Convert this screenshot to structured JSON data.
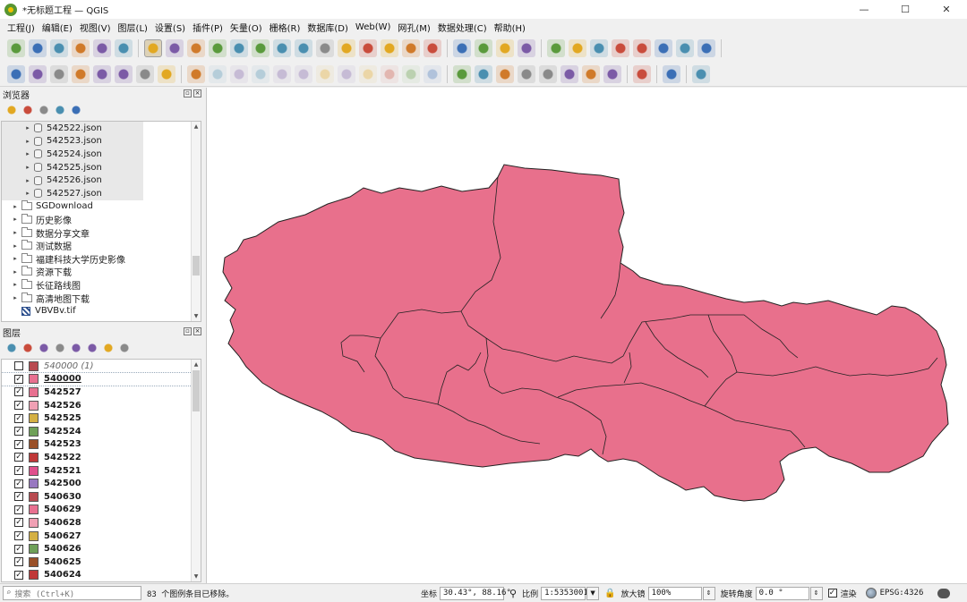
{
  "window": {
    "title": "*无标题工程 — QGIS",
    "controls": {
      "minimize": "—",
      "maximize": "☐",
      "close": "✕"
    }
  },
  "menu": [
    "工程(J)",
    "编辑(E)",
    "视图(V)",
    "图层(L)",
    "设置(S)",
    "插件(P)",
    "矢量(O)",
    "栅格(R)",
    "数据库(D)",
    "Web(W)",
    "网孔(M)",
    "数据处理(C)",
    "帮助(H)"
  ],
  "toolbar_icons": {
    "row1": [
      "new-project-icon",
      "open-project-icon",
      "save-project-icon",
      "new-print-layout-icon",
      "layout-manager-icon",
      "style-manager-icon",
      "pan-icon",
      "pan-to-selection-icon",
      "zoom-in-icon",
      "zoom-out-icon",
      "zoom-full-icon",
      "zoom-to-selection-icon",
      "zoom-to-layer-icon",
      "zoom-native-icon",
      "zoom-last-icon",
      "zoom-next-icon",
      "new-bookmark-icon",
      "show-bookmarks-icon",
      "temporal-controller-icon",
      "refresh-icon",
      "select-features-icon",
      "select-by-value-icon",
      "deselect-icon",
      "select-by-location-icon",
      "identify-icon",
      "attribute-table-icon",
      "processing-toolbox-icon",
      "statistics-icon",
      "open-table-icon",
      "measure-icon",
      "map-tips-icon",
      "locator-icon"
    ],
    "row2": [
      "data-source-manager-icon",
      "new-geopackage-icon",
      "new-shapefile-icon",
      "digitize-icon",
      "new-virtual-layer-icon",
      "new-mesh-icon",
      "qgis-cloud-icon",
      "current-edits-icon",
      "toggle-editing-icon",
      "save-edits-icon",
      "digitize-point-icon",
      "vertex-tool-icon",
      "advanced-digitize-icon",
      "modify-attributes-icon",
      "delete-selected-icon",
      "cut-icon",
      "copy-icon",
      "paste-icon",
      "undo-icon",
      "redo-icon",
      "label-icon",
      "label-tool-icon",
      "pin-labels-icon",
      "highlight-labels-icon",
      "move-label-icon",
      "rotate-label-icon",
      "change-label-icon",
      "show-hide-labels-icon",
      "diagram-icon",
      "python-console-icon",
      "help-icon"
    ]
  },
  "browser_panel": {
    "title": "浏览器",
    "tools": [
      "add-layer-icon",
      "refresh-icon",
      "filter-icon",
      "collapse-all-icon",
      "info-icon"
    ],
    "items": [
      {
        "label": "542522.json",
        "kind": "db",
        "indent": 2
      },
      {
        "label": "542523.json",
        "kind": "db",
        "indent": 2
      },
      {
        "label": "542524.json",
        "kind": "db",
        "indent": 2
      },
      {
        "label": "542525.json",
        "kind": "db",
        "indent": 2
      },
      {
        "label": "542526.json",
        "kind": "db",
        "indent": 2
      },
      {
        "label": "542527.json",
        "kind": "db",
        "indent": 2
      },
      {
        "label": "SGDownload",
        "kind": "folder",
        "indent": 1
      },
      {
        "label": "历史影像",
        "kind": "folder",
        "indent": 1
      },
      {
        "label": "数据分享文章",
        "kind": "folder",
        "indent": 1
      },
      {
        "label": "测试数据",
        "kind": "folder",
        "indent": 1
      },
      {
        "label": "福建科技大学历史影像",
        "kind": "folder",
        "indent": 1
      },
      {
        "label": "资源下载",
        "kind": "folder",
        "indent": 1
      },
      {
        "label": "长征路线图",
        "kind": "folder",
        "indent": 1
      },
      {
        "label": "高清地图下载",
        "kind": "folder",
        "indent": 1
      },
      {
        "label": "VBVBv.tif",
        "kind": "raster",
        "indent": 1
      }
    ]
  },
  "layers_panel": {
    "title": "图层",
    "tools": [
      "style-icon",
      "add-group-icon",
      "visibility-icon",
      "filter-icon",
      "filter-legend-icon",
      "expand-icon",
      "collapse-icon",
      "remove-layer-icon"
    ],
    "layers": [
      {
        "name": "540000 (1)",
        "checked": false,
        "color": "#b84a50",
        "style": "italic"
      },
      {
        "name": "540000",
        "checked": true,
        "color": "#e87090",
        "style": "current"
      },
      {
        "name": "542527",
        "checked": true,
        "color": "#e87090",
        "style": "bold"
      },
      {
        "name": "542526",
        "checked": true,
        "color": "#f0a0b4",
        "style": "bold"
      },
      {
        "name": "542525",
        "checked": true,
        "color": "#d4b044",
        "style": "bold"
      },
      {
        "name": "542524",
        "checked": true,
        "color": "#6ea058",
        "style": "bold"
      },
      {
        "name": "542523",
        "checked": true,
        "color": "#9a5028",
        "style": "bold"
      },
      {
        "name": "542522",
        "checked": true,
        "color": "#c03838",
        "style": "bold"
      },
      {
        "name": "542521",
        "checked": true,
        "color": "#e0508c",
        "style": "bold"
      },
      {
        "name": "542500",
        "checked": true,
        "color": "#9878c0",
        "style": "bold"
      },
      {
        "name": "540630",
        "checked": true,
        "color": "#b84a50",
        "style": "bold"
      },
      {
        "name": "540629",
        "checked": true,
        "color": "#e87090",
        "style": "bold"
      },
      {
        "name": "540628",
        "checked": true,
        "color": "#f0a0b4",
        "style": "bold"
      },
      {
        "name": "540627",
        "checked": true,
        "color": "#d4b044",
        "style": "bold"
      },
      {
        "name": "540626",
        "checked": true,
        "color": "#6ea058",
        "style": "bold"
      },
      {
        "name": "540625",
        "checked": true,
        "color": "#9a5028",
        "style": "bold"
      },
      {
        "name": "540624",
        "checked": true,
        "color": "#c03838",
        "style": "bold"
      }
    ]
  },
  "map": {
    "fill_color": "#e8708c",
    "stroke_color": "#222222",
    "background": "#ffffff"
  },
  "status": {
    "search_placeholder": "搜索 (Ctrl+K)",
    "message": "83 个图例条目已移除。",
    "coordinate_label": "坐标",
    "coordinate_value": "30.43°, 88.16°",
    "scale_label": "比例",
    "scale_value": "1:5353001",
    "magnifier_label": "放大镜",
    "magnifier_value": "100%",
    "rotation_label": "旋转角度",
    "rotation_value": "0.0 °",
    "render_label": "渲染",
    "render_checked": "✓",
    "crs_label": "EPSG:4326"
  }
}
